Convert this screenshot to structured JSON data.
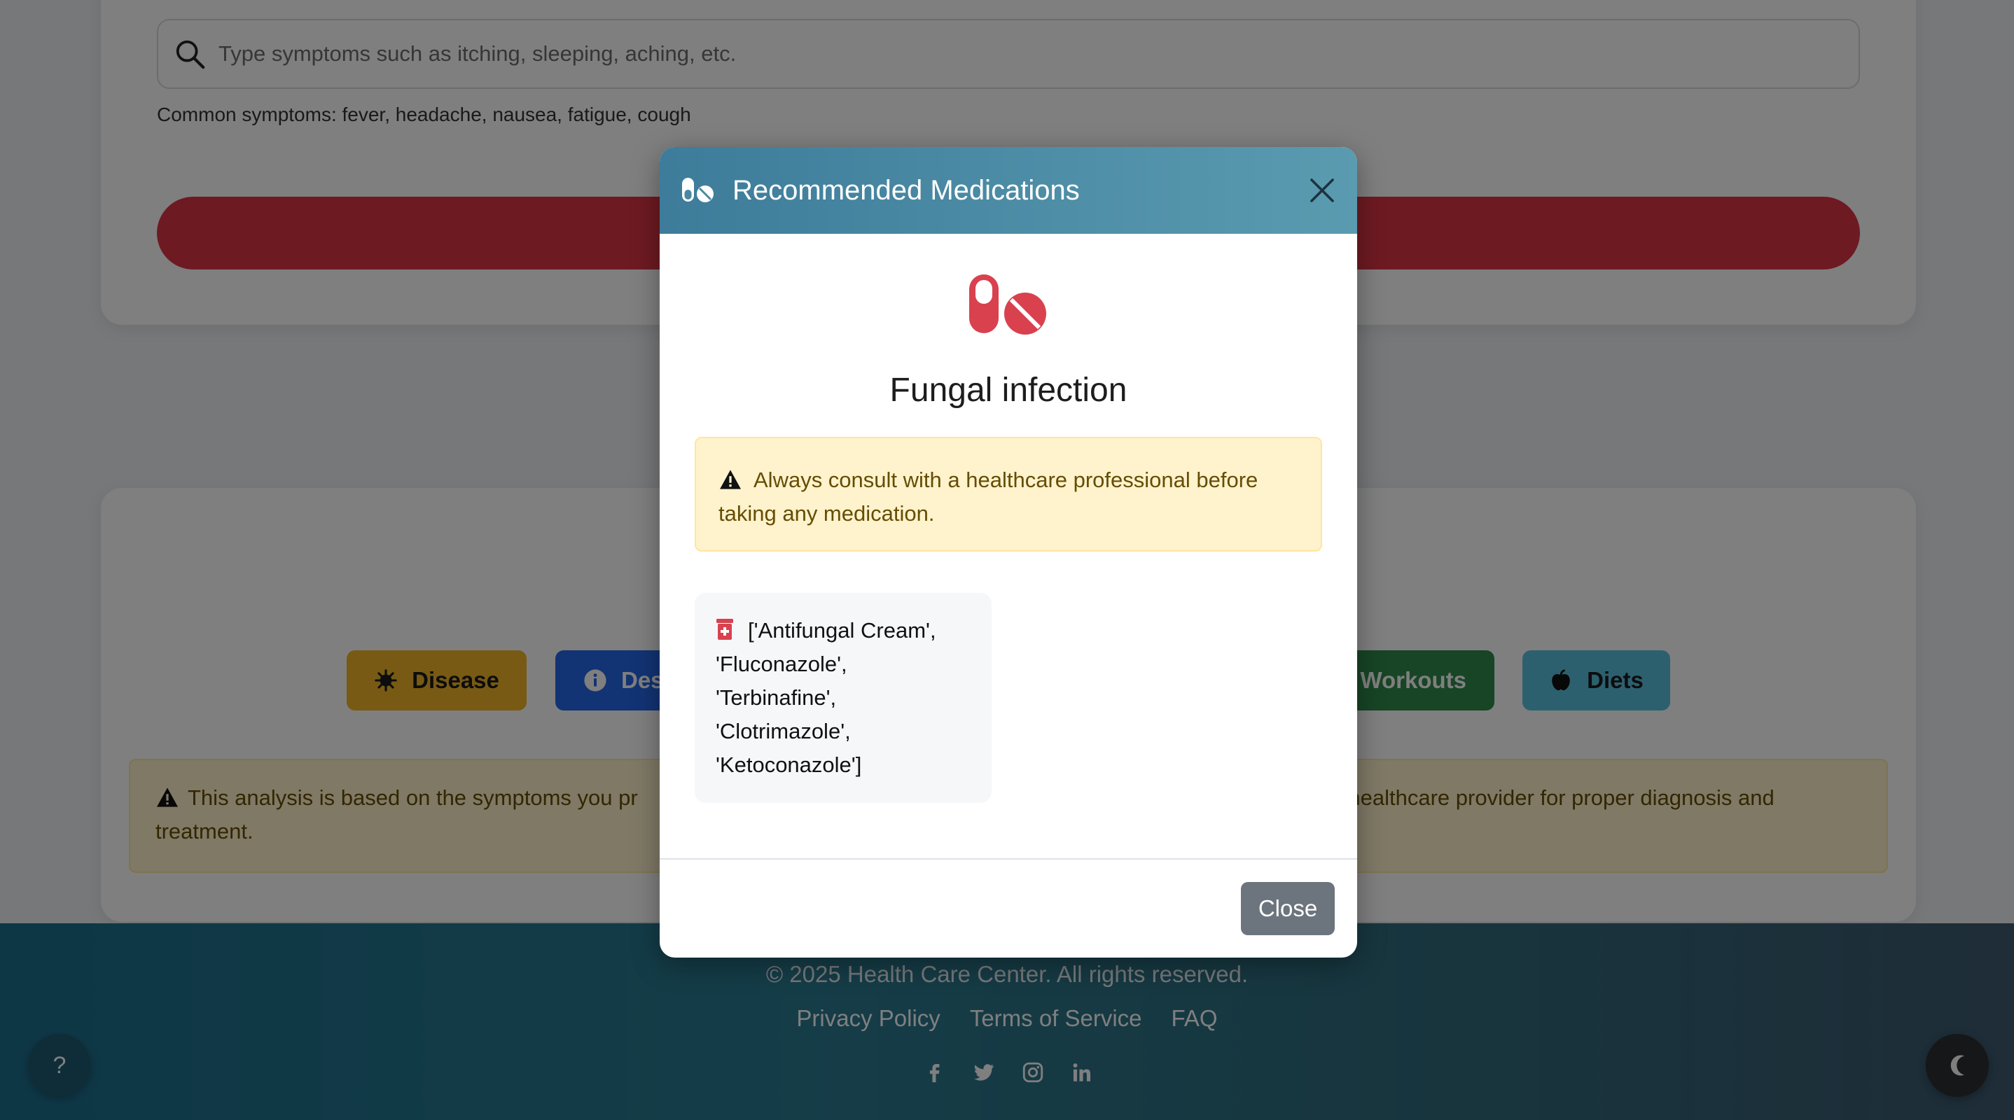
{
  "search": {
    "placeholder": "Type symptoms such as itching, sleeping, aching, etc.",
    "common_symptoms": "Common symptoms: fever, headache, nausea, fatigue, cough"
  },
  "results": {
    "buttons": {
      "disease": "Disease",
      "description": "Des",
      "workouts": "Workouts",
      "diets": "Diets"
    },
    "notice_left": "This analysis is based on the symptoms you pr",
    "notice_right": "sult a healthcare provider for proper diagnosis and",
    "notice_line2": "treatment."
  },
  "footer": {
    "copyright": "© 2025 Health Care Center. All rights reserved.",
    "links": [
      "Privacy Policy",
      "Terms of Service",
      "FAQ"
    ],
    "social_icons": [
      "facebook-icon",
      "twitter-icon",
      "instagram-icon",
      "linkedin-icon"
    ],
    "help_label": "?"
  },
  "modal": {
    "title": "Recommended Medications",
    "disease": "Fungal infection",
    "warning": "Always consult with a healthcare professional before taking any medication.",
    "medications_line1": "['Antifungal Cream',",
    "medications_line2": "'Fluconazole',",
    "medications_line3": "'Terbinafine',",
    "medications_line4": "'Clotrimazole',",
    "medications_line5": "'Ketoconazole']",
    "close_label": "Close"
  },
  "colors": {
    "accent_red": "#dc3545",
    "header_teal": "#3d7c9a",
    "warning_bg": "#fff3cd"
  }
}
